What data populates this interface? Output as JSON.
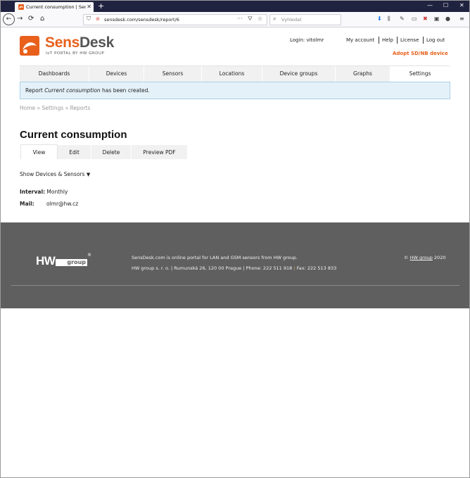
{
  "browser": {
    "tab_title": "Current consumption | SensDesk",
    "new_tab": "+",
    "url": "sensdesk.com/sensdesk/report/6",
    "search_placeholder": "Vyhledat",
    "window_controls": [
      "—",
      "☐",
      "✕"
    ]
  },
  "header": {
    "logo_sens": "Sens",
    "logo_desk": "Desk",
    "logo_sub": "IoT PORTAL BY HW GROUP",
    "login_label": "Login: vitolmr",
    "links": [
      "My account",
      "Help",
      "License",
      "Log out"
    ],
    "adopt": "Adopt SD/NB device"
  },
  "nav": {
    "items": [
      "Dashboards",
      "Devices",
      "Sensors",
      "Locations",
      "Device groups",
      "Graphs",
      "Settings"
    ],
    "active": "Settings"
  },
  "alert": {
    "prefix": "Report ",
    "name": "Current consumption",
    "suffix": " has been created."
  },
  "breadcrumb": {
    "home": "Home",
    "settings": "Settings",
    "reports": "Reports",
    "sep": "»"
  },
  "page": {
    "title": "Current consumption",
    "tabs": [
      "View",
      "Edit",
      "Delete",
      "Preview PDF"
    ],
    "active_tab": "View",
    "show_devices": "Show Devices & Sensors",
    "interval_label": "Interval:",
    "interval_value": "Monthly",
    "mail_label": "Mail:",
    "mail_value": "olmr@hw.cz"
  },
  "footer": {
    "logo_hw": "HW",
    "logo_group": "group",
    "logo_reg": "®",
    "desc": "SensDesk.com is online portal for LAN and GSM sensors from HW group.",
    "address": "HW group s. r. o. | Rumunská 26, 120 00 Prague | Phone: 222 511 918",
    "fax_sep": "|",
    "fax": "Fax: 222 513 833",
    "copy_symbol": "©",
    "copy_link": "HW group",
    "copy_year": "2020"
  },
  "colors": {
    "brand_orange": "#e8601c",
    "footer_bg": "#5f5f5f",
    "alert_bg": "#e5f1f9",
    "titlebar_bg": "#202340"
  }
}
